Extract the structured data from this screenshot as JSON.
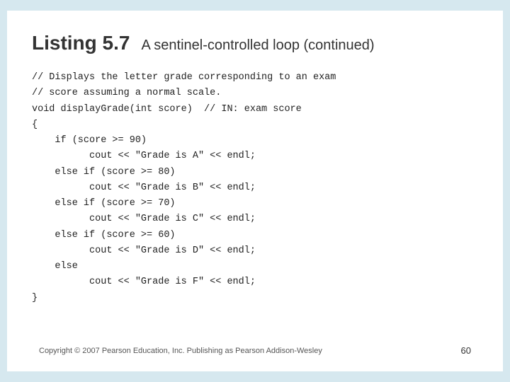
{
  "slide": {
    "title_listing": "Listing 5.7",
    "title_subtitle": "A sentinel-controlled loop (continued)",
    "code": "// Displays the letter grade corresponding to an exam\n// score assuming a normal scale.\nvoid displayGrade(int score)  // IN: exam score\n{\n    if (score >= 90)\n          cout << \"Grade is A\" << endl;\n    else if (score >= 80)\n          cout << \"Grade is B\" << endl;\n    else if (score >= 70)\n          cout << \"Grade is C\" << endl;\n    else if (score >= 60)\n          cout << \"Grade is D\" << endl;\n    else\n          cout << \"Grade is F\" << endl;\n}",
    "footer_copyright": "Copyright © 2007 Pearson Education, Inc. Publishing as Pearson Addison-Wesley",
    "footer_page": "60"
  }
}
